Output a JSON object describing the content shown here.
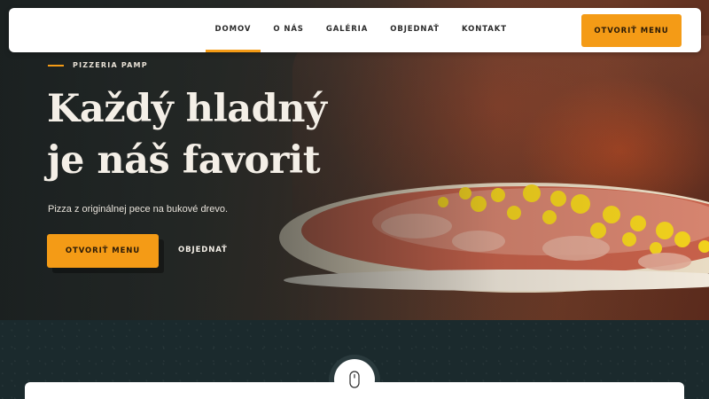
{
  "nav": {
    "items": [
      {
        "label": "DOMOV",
        "active": true
      },
      {
        "label": "O NÁS",
        "active": false
      },
      {
        "label": "GALÉRIA",
        "active": false
      },
      {
        "label": "OBJEDNAŤ",
        "active": false
      },
      {
        "label": "KONTAKT",
        "active": false
      }
    ],
    "menu_button": "OTVORIŤ MENU"
  },
  "hero": {
    "eyebrow": "PIZZERIA PAMP",
    "headline_line1": "Každý hladný",
    "headline_line2": "je náš favorit",
    "subtitle": "Pizza z originálnej pece na bukové drevo.",
    "primary_button": "OTVORIŤ MENU",
    "secondary_link": "OBJEDNAŤ"
  },
  "icons": {
    "scroll": "mouse-scroll-icon"
  },
  "colors": {
    "accent": "#f49b16",
    "dark_section": "#1b2a2d",
    "headline": "#f4efe7"
  }
}
